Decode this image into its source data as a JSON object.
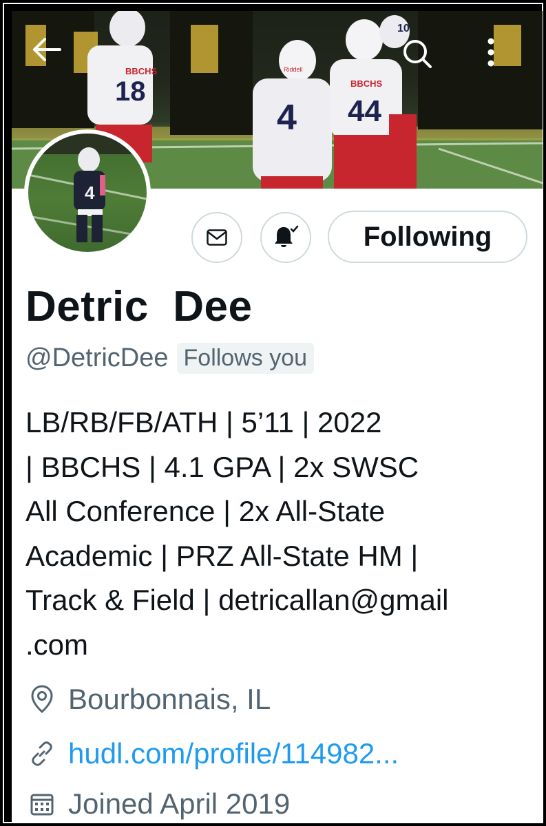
{
  "header": {
    "back_icon": "arrow-left-icon",
    "search_icon": "search-icon",
    "more_icon": "more-vertical-icon",
    "banner": {
      "jersey_numbers": [
        "18",
        "4",
        "44",
        "10"
      ],
      "jersey_text": [
        "BBCHS",
        "BBCHS"
      ],
      "helmet_text": "Riddell"
    }
  },
  "avatar": {
    "jersey_number": "4"
  },
  "actions": {
    "message_icon": "mail-icon",
    "notify_icon": "bell-check-icon",
    "follow_label": "Following"
  },
  "profile": {
    "name": "Detric  Dee",
    "handle": "@DetricDee",
    "follows_you": "Follows you",
    "bio_lines": [
      "LB/RB/FB/ATH | 5’11 | 2022",
      "| BBCHS | 4.1 GPA | 2x SWSC",
      "All Conference | 2x All-State",
      "Academic | PRZ All-State HM |",
      "Track & Field | detricallan@gmail",
      ".com"
    ],
    "location": "Bourbonnais, IL",
    "link": "hudl.com/profile/114982...",
    "joined": "Joined April 2019"
  },
  "colors": {
    "text_primary": "#0f1419",
    "text_secondary": "#536471",
    "link": "#1d9bf0",
    "border": "#cfd9de",
    "jersey_red": "#c8262f"
  }
}
